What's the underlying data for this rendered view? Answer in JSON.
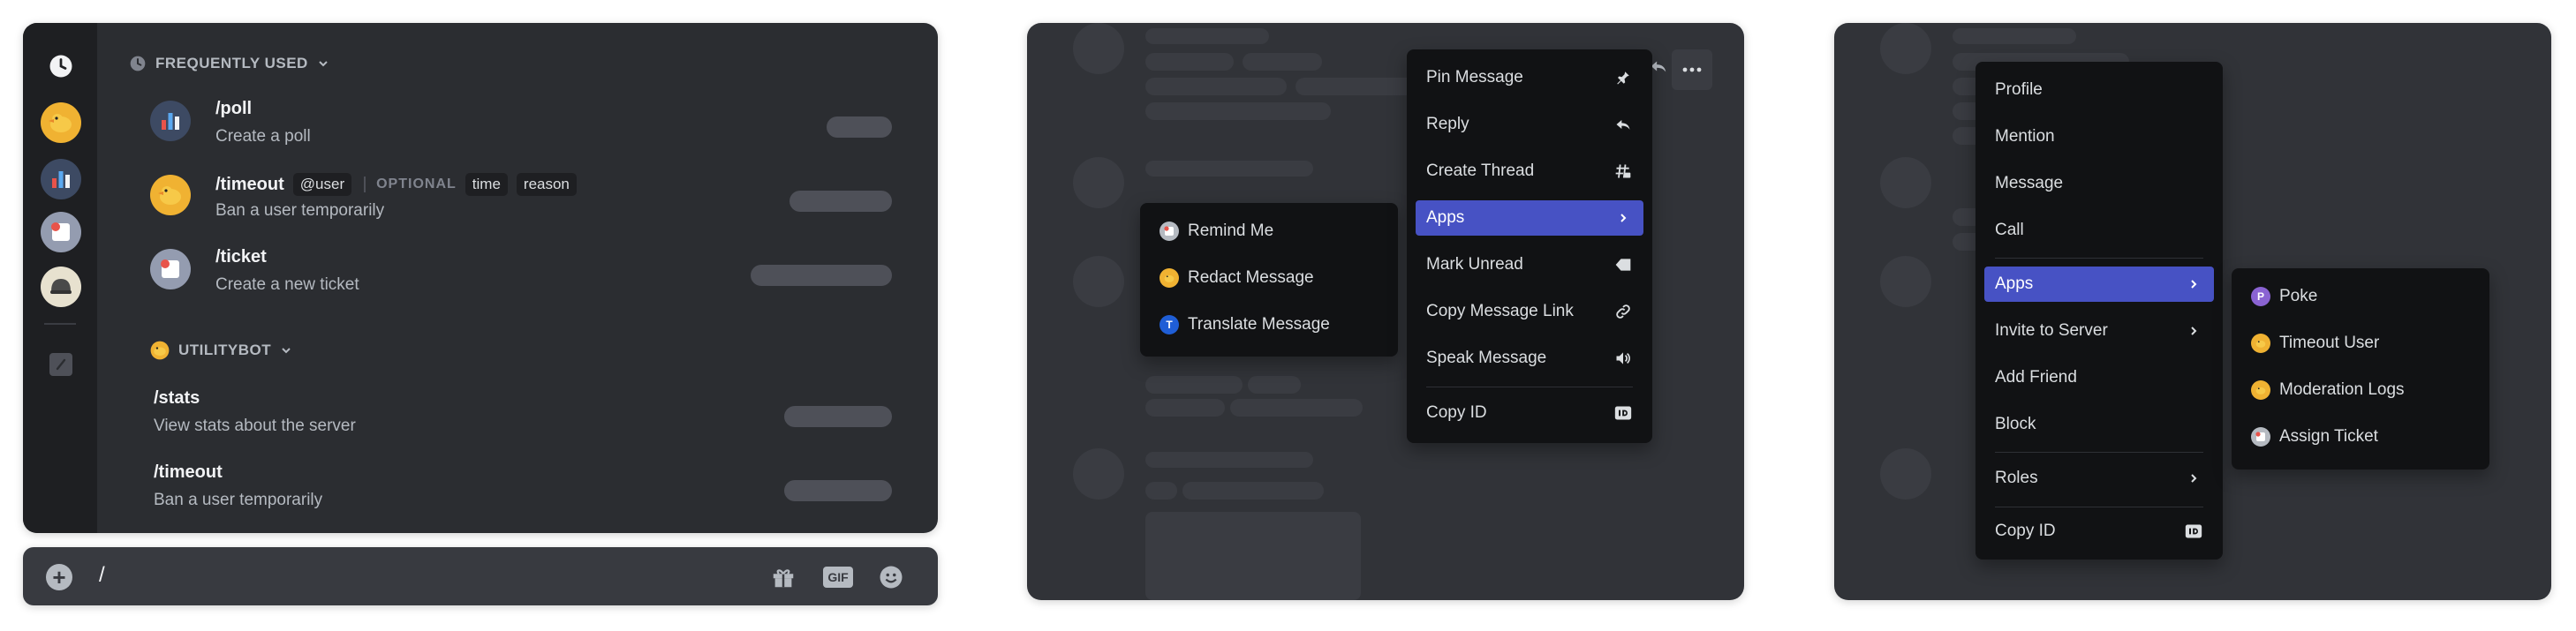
{
  "commands_panel": {
    "frequently_used": {
      "title": "FREQUENTLY USED",
      "items": [
        {
          "name": "/poll",
          "description": "Create a poll"
        },
        {
          "name": "/timeout",
          "arg_required": "@user",
          "optional_label": "OPTIONAL",
          "optional_args": [
            "time",
            "reason"
          ],
          "description": "Ban a user temporarily"
        },
        {
          "name": "/ticket",
          "description": "Create a new ticket"
        }
      ]
    },
    "utilitybot": {
      "title": "UTILITYBOT",
      "items": [
        {
          "name": "/stats",
          "description": "View stats about the server"
        },
        {
          "name": "/timeout",
          "description": "Ban a user temporarily"
        }
      ]
    },
    "input": {
      "value": "/"
    },
    "rail_icons": [
      "clock-icon",
      "duck-bot-icon",
      "chart-bot-icon",
      "ticket-bot-icon",
      "helmet-bot-icon",
      "slash-icon"
    ]
  },
  "message_menu": {
    "items": [
      {
        "label": "Pin Message",
        "icon": "pin-icon"
      },
      {
        "label": "Reply",
        "icon": "reply-icon"
      },
      {
        "label": "Create Thread",
        "icon": "thread-icon"
      },
      {
        "label": "Apps",
        "icon": "chevron-right-icon",
        "active": true
      },
      {
        "label": "Mark Unread",
        "icon": "mark-unread-icon"
      },
      {
        "label": "Copy Message Link",
        "icon": "link-icon"
      },
      {
        "label": "Speak Message",
        "icon": "speaker-icon"
      },
      {
        "label": "Copy ID",
        "icon": "id-icon"
      }
    ],
    "apps_submenu": [
      {
        "label": "Remind Me",
        "icon": "remind-app-icon"
      },
      {
        "label": "Redact Message",
        "icon": "duck-app-icon"
      },
      {
        "label": "Translate Message",
        "icon": "translate-app-icon",
        "badge": "T"
      }
    ]
  },
  "user_menu": {
    "items": [
      {
        "label": "Profile"
      },
      {
        "label": "Mention"
      },
      {
        "label": "Message"
      },
      {
        "label": "Call"
      },
      {
        "label": "Apps",
        "active": true
      },
      {
        "label": "Invite to Server"
      },
      {
        "label": "Add Friend"
      },
      {
        "label": "Block"
      },
      {
        "label": "Roles"
      },
      {
        "label": "Copy ID"
      }
    ],
    "apps_submenu": [
      {
        "label": "Poke",
        "badge": "P"
      },
      {
        "label": "Timeout User"
      },
      {
        "label": "Moderation Logs"
      },
      {
        "label": "Assign Ticket"
      }
    ]
  },
  "colors": {
    "accent": "#4752c4",
    "menu_bg": "#111214",
    "panel_bg": "#313338",
    "skeleton": "#3a3c42"
  }
}
